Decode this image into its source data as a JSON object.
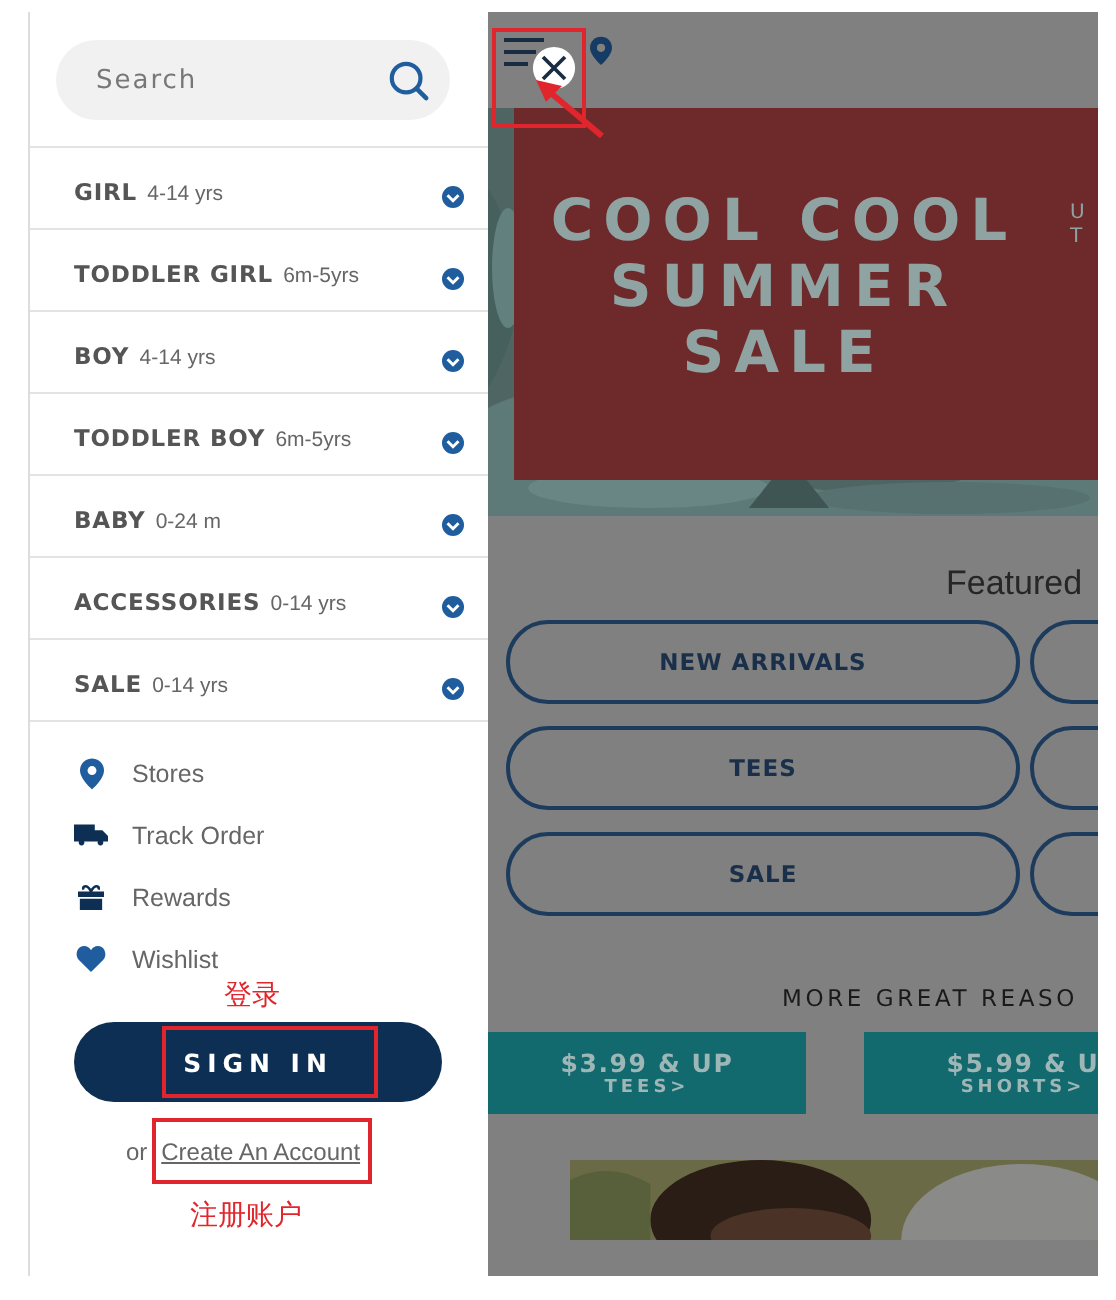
{
  "drawer": {
    "search": {
      "placeholder": "Search"
    },
    "categories": [
      {
        "label": "GIRL",
        "range": "4-14 yrs",
        "expanded": false
      },
      {
        "label": "TODDLER GIRL",
        "range": "6m-5yrs",
        "expanded": false
      },
      {
        "label": "BOY",
        "range": "4-14 yrs",
        "expanded": false
      },
      {
        "label": "TODDLER BOY",
        "range": "6m-5yrs",
        "expanded": false
      },
      {
        "label": "BABY",
        "range": "0-24 m",
        "expanded": false
      },
      {
        "label": "ACCESSORIES",
        "range": "0-14 yrs",
        "expanded": false
      },
      {
        "label": "SALE",
        "range": "0-14 yrs",
        "expanded": false
      }
    ],
    "links": [
      {
        "kind": "stores",
        "label": "Stores"
      },
      {
        "kind": "track",
        "label": "Track Order"
      },
      {
        "kind": "rewards",
        "label": "Rewards"
      },
      {
        "kind": "wishlist",
        "label": "Wishlist"
      }
    ],
    "sign_in": "SIGN IN",
    "create_account": {
      "prefix": "or",
      "link": "Create An Account"
    }
  },
  "page": {
    "banner": {
      "lines": [
        "COOL COOL",
        "SUMMER",
        "SALE"
      ],
      "side_text": [
        "U",
        "T"
      ]
    },
    "featured_heading": "Featured",
    "featured_buttons": [
      "NEW ARRIVALS",
      "TEES",
      "SALE"
    ],
    "reasons_heading": "MORE GREAT REASO",
    "promos": [
      {
        "price": "$3.99 & UP",
        "label": "TEES>"
      },
      {
        "price": "$5.99 & U",
        "label": "SHORTS>"
      }
    ]
  },
  "annotations": {
    "sign_in_note": "登录",
    "create_account_note": "注册账户"
  }
}
